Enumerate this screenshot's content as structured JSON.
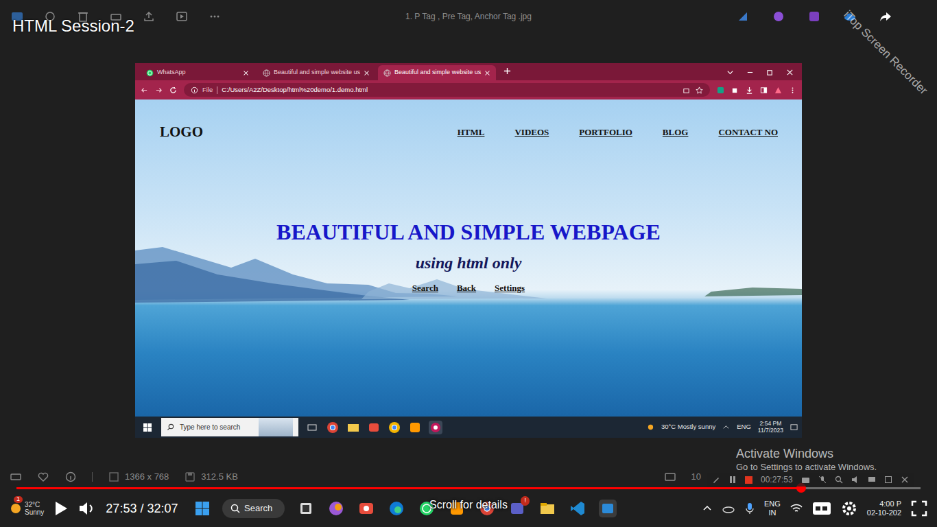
{
  "player": {
    "title": "HTML Session-2",
    "time": "27:53 / 32:07",
    "progress": 0.868,
    "scroll_hint": "Scroll for details"
  },
  "viewer": {
    "filename": "1. P Tag , Pre Tag, Anchor Tag .jpg",
    "dimensions": "1366 x 768",
    "filesize": "312.5 KB",
    "zoom": "10"
  },
  "watermark": "iTop Screen Recorder",
  "recorder": {
    "time": "00:27:53"
  },
  "activation": {
    "title": "Activate Windows",
    "text": "Go to Settings to activate Windows."
  },
  "browser": {
    "tabs": [
      {
        "label": "WhatsApp",
        "selected": false,
        "kind": "whatsapp"
      },
      {
        "label": "Beautiful and simple website us",
        "selected": false,
        "kind": "web"
      },
      {
        "label": "Beautiful and simple website us",
        "selected": true,
        "kind": "web"
      }
    ],
    "address_prefix": "File",
    "address": "C:/Users/A2Z/Desktop/html%20demo/1.demo.html"
  },
  "webpage": {
    "logo": "LOGO",
    "nav": [
      "HTML",
      "VIDEOS",
      "PORTFOLIO",
      "BLOG",
      "CONTACT NO"
    ],
    "heading": "BEAUTIFUL AND SIMPLE WEBPAGE",
    "subheading": "using html only",
    "links": [
      "Search",
      "Back",
      "Settings"
    ]
  },
  "inner_taskbar": {
    "search_placeholder": "Type here to search",
    "weather": "30°C  Mostly sunny",
    "lang": "ENG",
    "time": "2:54 PM",
    "date": "11/7/2023"
  },
  "host_taskbar": {
    "weather_badge": "1",
    "weather_temp": "32°C",
    "weather_text": "Sunny",
    "search": "Search",
    "teams_badge": "!",
    "lang": "ENG",
    "region": "IN",
    "time": "4:00 P",
    "date": "02-10-202"
  }
}
